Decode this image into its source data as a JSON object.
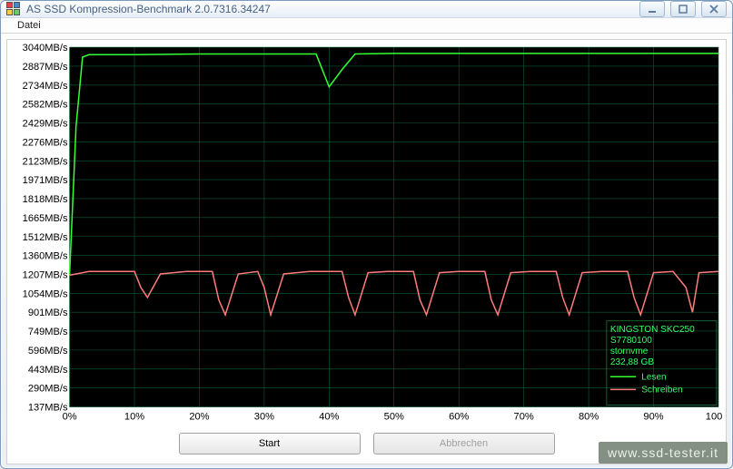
{
  "window": {
    "title": "AS SSD Kompression-Benchmark 2.0.7316.34247"
  },
  "menubar": {
    "file": "Datei"
  },
  "buttons": {
    "start": "Start",
    "cancel": "Abbrechen"
  },
  "watermark": "www.ssd-tester.it",
  "legend": {
    "device": "KINGSTON SKC250",
    "fw": "S7780100",
    "driver": "stornvme",
    "capacity": "232,88 GB",
    "read": "Lesen",
    "write": "Schreiben"
  },
  "chart_data": {
    "type": "line",
    "xlabel": "",
    "ylabel": "",
    "x_unit": "%",
    "y_unit": "MB/s",
    "xlim": [
      0,
      100
    ],
    "ylim": [
      137,
      3040
    ],
    "y_ticks": [
      3040,
      2887,
      2734,
      2582,
      2429,
      2276,
      2123,
      1971,
      1818,
      1665,
      1512,
      1360,
      1207,
      1054,
      901,
      749,
      596,
      443,
      290,
      137
    ],
    "y_tick_labels": [
      "3040MB/s",
      "2887MB/s",
      "2734MB/s",
      "2582MB/s",
      "2429MB/s",
      "2276MB/s",
      "2123MB/s",
      "1971MB/s",
      "1818MB/s",
      "1665MB/s",
      "1512MB/s",
      "1360MB/s",
      "1207MB/s",
      "1054MB/s",
      "901MB/s",
      "749MB/s",
      "596MB/s",
      "443MB/s",
      "290MB/s",
      "137MB/s"
    ],
    "x_ticks": [
      0,
      10,
      20,
      30,
      40,
      50,
      60,
      70,
      80,
      90,
      100
    ],
    "x_tick_labels": [
      "0%",
      "10%",
      "20%",
      "30%",
      "40%",
      "50%",
      "60%",
      "70%",
      "80%",
      "90%",
      "100%"
    ],
    "series": [
      {
        "name": "Lesen",
        "color": "#33ff33",
        "x": [
          0,
          1,
          2,
          3,
          10,
          20,
          30,
          35,
          38,
          40,
          42,
          44,
          50,
          60,
          70,
          80,
          90,
          100
        ],
        "values": [
          1200,
          2400,
          2960,
          2980,
          2980,
          2985,
          2985,
          2985,
          2985,
          2720,
          2860,
          2985,
          2990,
          2990,
          2990,
          2990,
          2990,
          2990
        ]
      },
      {
        "name": "Schreiben",
        "color": "#ff7b7b",
        "x": [
          0,
          3,
          5,
          8,
          10,
          11,
          12,
          14,
          18,
          22,
          23,
          24,
          26,
          29,
          30,
          31,
          33,
          37,
          42,
          43,
          44,
          46,
          49,
          53,
          54,
          55,
          57,
          60,
          64,
          65,
          66,
          68,
          71,
          75,
          76,
          77,
          79,
          82,
          86,
          87,
          88,
          90,
          93,
          95,
          96,
          97,
          100
        ],
        "values": [
          1200,
          1230,
          1230,
          1230,
          1230,
          1100,
          1020,
          1210,
          1230,
          1230,
          1000,
          880,
          1210,
          1230,
          1100,
          880,
          1210,
          1230,
          1230,
          1020,
          880,
          1220,
          1230,
          1230,
          1000,
          880,
          1220,
          1230,
          1230,
          1000,
          880,
          1220,
          1230,
          1230,
          1020,
          880,
          1220,
          1230,
          1230,
          1020,
          880,
          1220,
          1230,
          1100,
          900,
          1220,
          1230
        ]
      }
    ]
  }
}
